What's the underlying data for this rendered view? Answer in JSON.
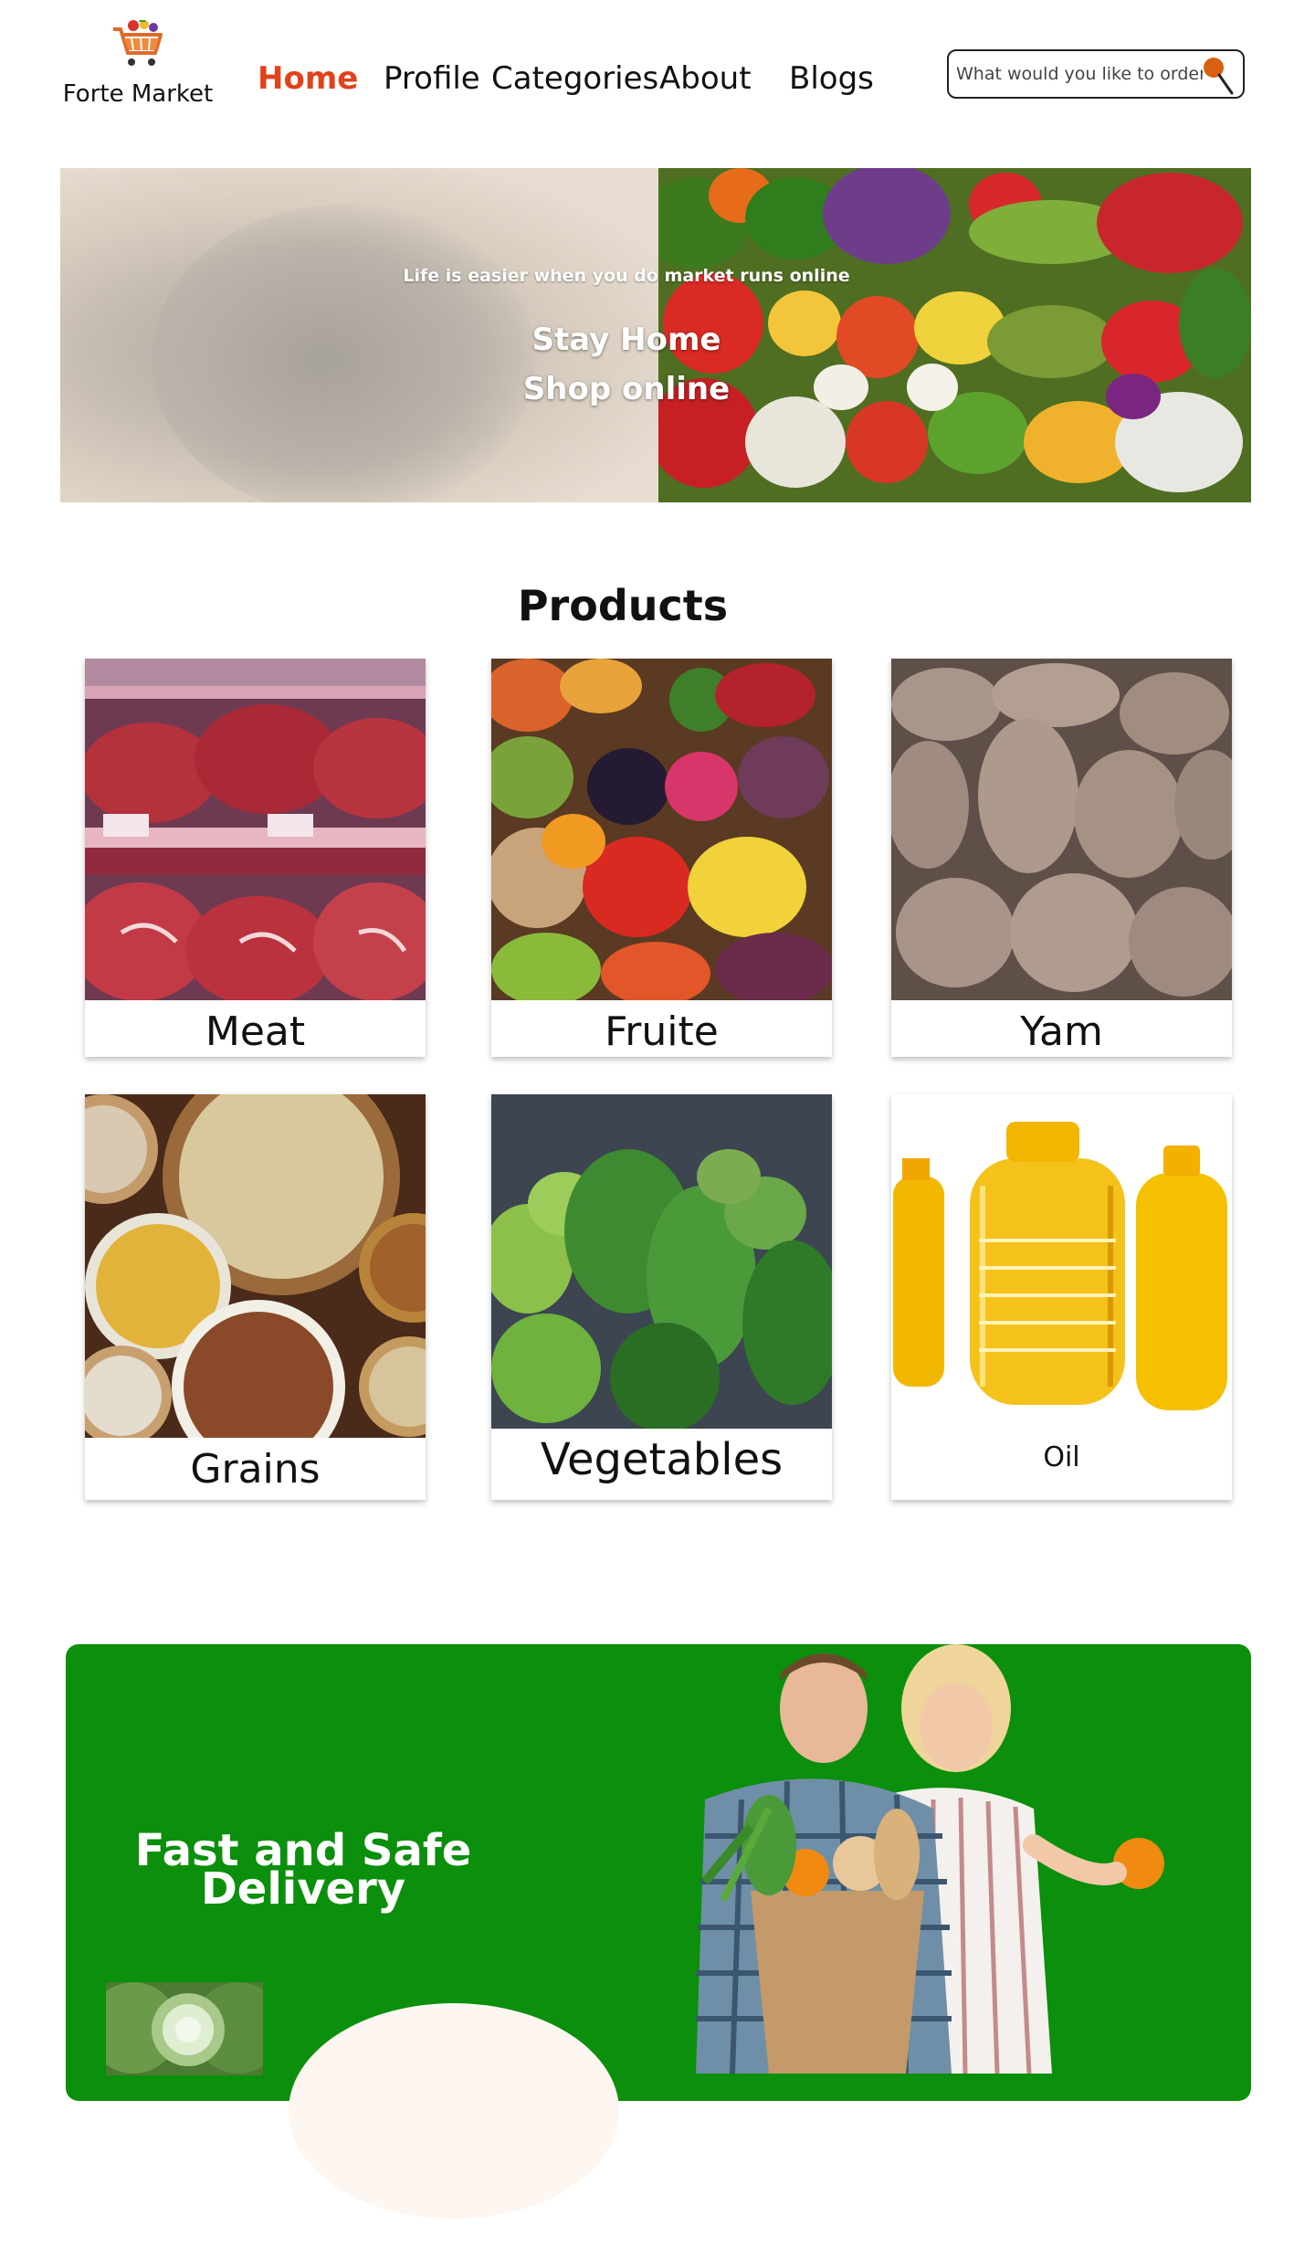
{
  "brand": {
    "name": "Forte Market"
  },
  "nav": {
    "items": [
      {
        "label": "Home",
        "active": true
      },
      {
        "label": "Profile",
        "active": false
      },
      {
        "label": "Categories",
        "active": false
      },
      {
        "label": "About",
        "active": false
      },
      {
        "label": "Blogs",
        "active": false
      }
    ]
  },
  "search": {
    "placeholder": "What would you like to order?",
    "icon": "search-icon"
  },
  "hero": {
    "tagline": "Life is easier when you do market runs online",
    "line1": "Stay Home",
    "line2": "Shop online"
  },
  "products": {
    "title": "Products",
    "items": [
      {
        "label": "Meat"
      },
      {
        "label": "Fruite"
      },
      {
        "label": "Yam"
      },
      {
        "label": "Grains"
      },
      {
        "label": "Vegetables"
      },
      {
        "label": "Oil"
      }
    ]
  },
  "delivery": {
    "title": "Fast and Safe Delivery"
  },
  "colors": {
    "accent": "#e0421b",
    "banner": "#0b8f0c",
    "text": "#111111"
  }
}
